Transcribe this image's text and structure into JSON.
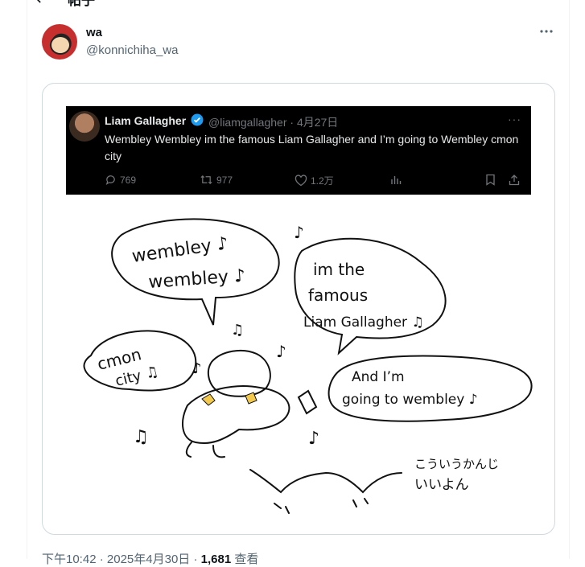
{
  "header": {
    "title": "帖子"
  },
  "author": {
    "name": "wa",
    "handle": "@konnichiha_wa"
  },
  "embedded_tweet": {
    "name": "Liam Gallagher",
    "handle": "@liamgallagher",
    "date": "4月27日",
    "text": "Wembley Wembley im the famous Liam Gallagher and I’m going to Wembley cmon city",
    "replies": "769",
    "retweets": "977",
    "likes": "1.2万"
  },
  "drawing": {
    "bubble1_line1": "wembley ♪",
    "bubble1_line2": "wembley ♪",
    "bubble2_line1": "im the",
    "bubble2_line2": "famous",
    "bubble2_line3": "Liam Gallagher ♫",
    "bubble3_line1": "cmon",
    "bubble3_line2": "city ♫",
    "bubble4_line1": "And I’m",
    "bubble4_line2": "going to wembley ♪",
    "note_line1": "こういうかんじ",
    "note_line2": "いいよん"
  },
  "footer": {
    "time": "下午10:42",
    "date": "2025年4月30日",
    "views": "1,681",
    "views_label": "查看"
  }
}
